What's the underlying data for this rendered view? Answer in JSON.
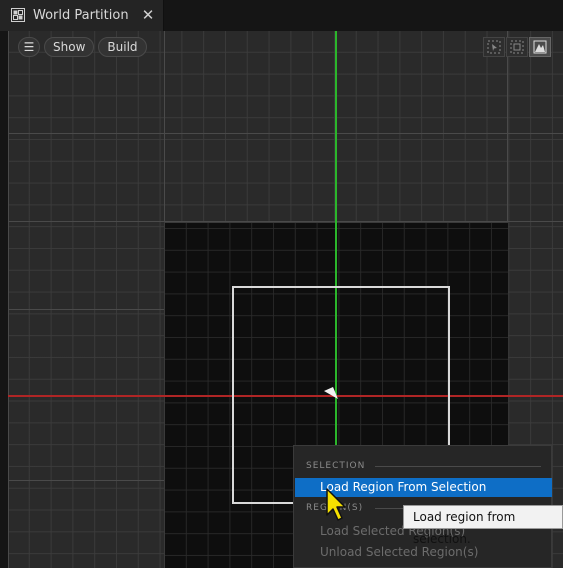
{
  "tab": {
    "title": "World Partition",
    "close_glyph": "✕",
    "icon": "world-partition-icon"
  },
  "toolbar": {
    "menu_glyph": "☰",
    "show_label": "Show",
    "build_label": "Build",
    "mode_icons": [
      "select-mode-icon",
      "marquee-mode-icon",
      "terrain-mode-icon"
    ]
  },
  "context_menu": {
    "selection_header": "SELECTION",
    "items": [
      {
        "label": "Load Region From Selection",
        "state": "highlighted"
      },
      {
        "label": "Load Selected Region(s)",
        "state": "disabled"
      },
      {
        "label": "Unload Selected Region(s)",
        "state": "disabled"
      }
    ],
    "regions_header": "REGION(S)"
  },
  "tooltip": {
    "text": "Load region from selection."
  },
  "colors": {
    "highlight": "#0e6ec6",
    "axis_x": "#b02525",
    "axis_y": "#2bb62b",
    "selection_border": "#d9d9d9"
  }
}
